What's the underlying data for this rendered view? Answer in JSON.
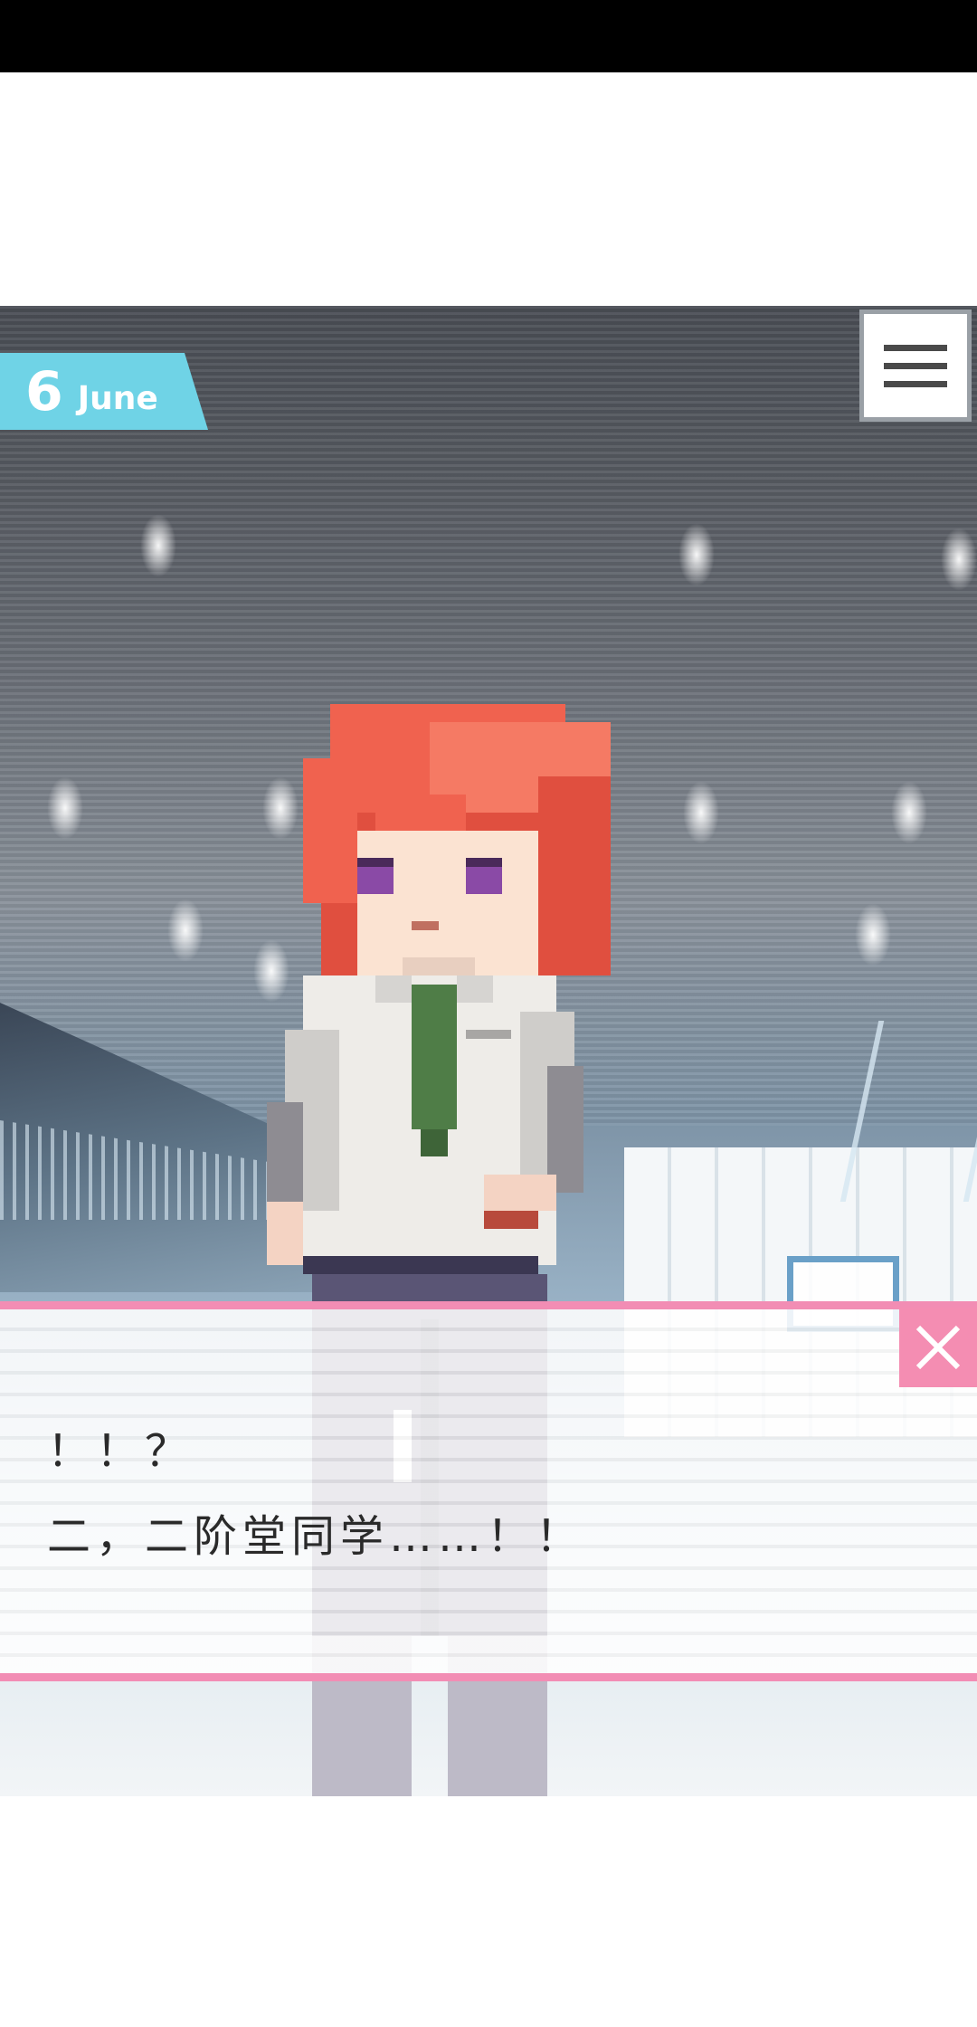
{
  "hud": {
    "date_day": "6",
    "date_month": "June",
    "menu_icon": "hamburger-menu-icon",
    "close_icon": "close-x-icon"
  },
  "dialogue": {
    "line1": "！！？",
    "line2": "二，二阶堂同学……！！"
  },
  "colors": {
    "date_banner": "#6fd3e6",
    "dialogue_border": "#f28db4",
    "close_button": "#f48db2",
    "hair": "#f0624f",
    "tie": "#4f7d47",
    "shirt": "#eeece8",
    "pants": "#5a5575"
  }
}
